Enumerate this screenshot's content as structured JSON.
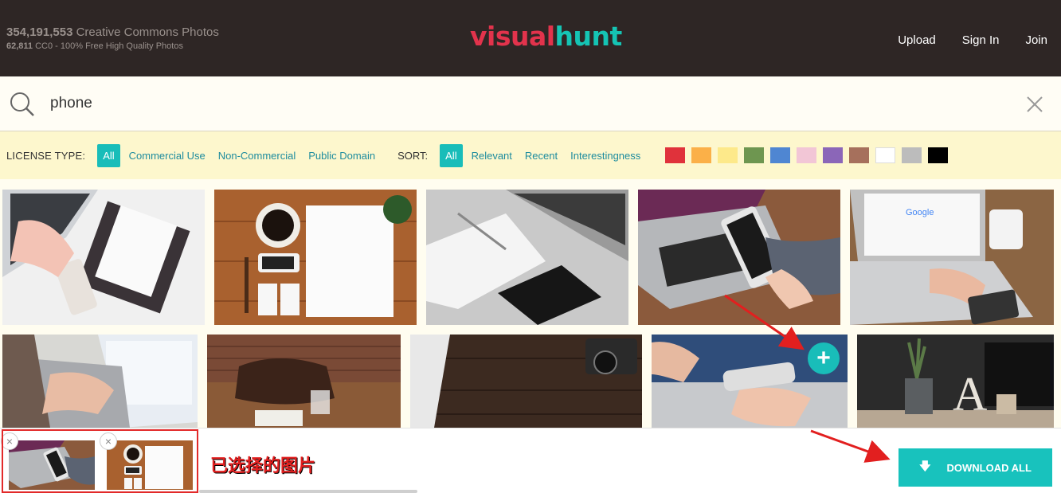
{
  "header": {
    "photo_count": "354,191,553",
    "photo_count_label": "Creative Commons Photos",
    "cc0_count": "62,811",
    "cc0_label": "CC0 - 100% Free High Quality Photos",
    "logo_v": "v",
    "logo_rest": "isual",
    "logo_hunt": "hunt",
    "nav": [
      "Upload",
      "Sign In",
      "Join"
    ]
  },
  "search": {
    "query": "phone"
  },
  "filters": {
    "license_label": "LICENSE TYPE:",
    "license_options": [
      "All",
      "Commercial Use",
      "Non-Commercial",
      "Public Domain"
    ],
    "sort_label": "SORT:",
    "sort_options": [
      "All",
      "Relevant",
      "Recent",
      "Interestingness"
    ],
    "colors": [
      "#e0323b",
      "#fbb048",
      "#fde98a",
      "#6e9650",
      "#4f86d2",
      "#f2c6d6",
      "#8b66b8",
      "#a6705c",
      "#ffffff",
      "#bcbcbc",
      "#000000"
    ]
  },
  "selection": {
    "caption": "已选择的图片",
    "download_label": "DOWNLOAD ALL",
    "selected_count": 2
  },
  "icons": {
    "search": "magnifier-icon",
    "clear": "close-icon",
    "add": "plus-icon",
    "download": "download-arrow-icon"
  }
}
